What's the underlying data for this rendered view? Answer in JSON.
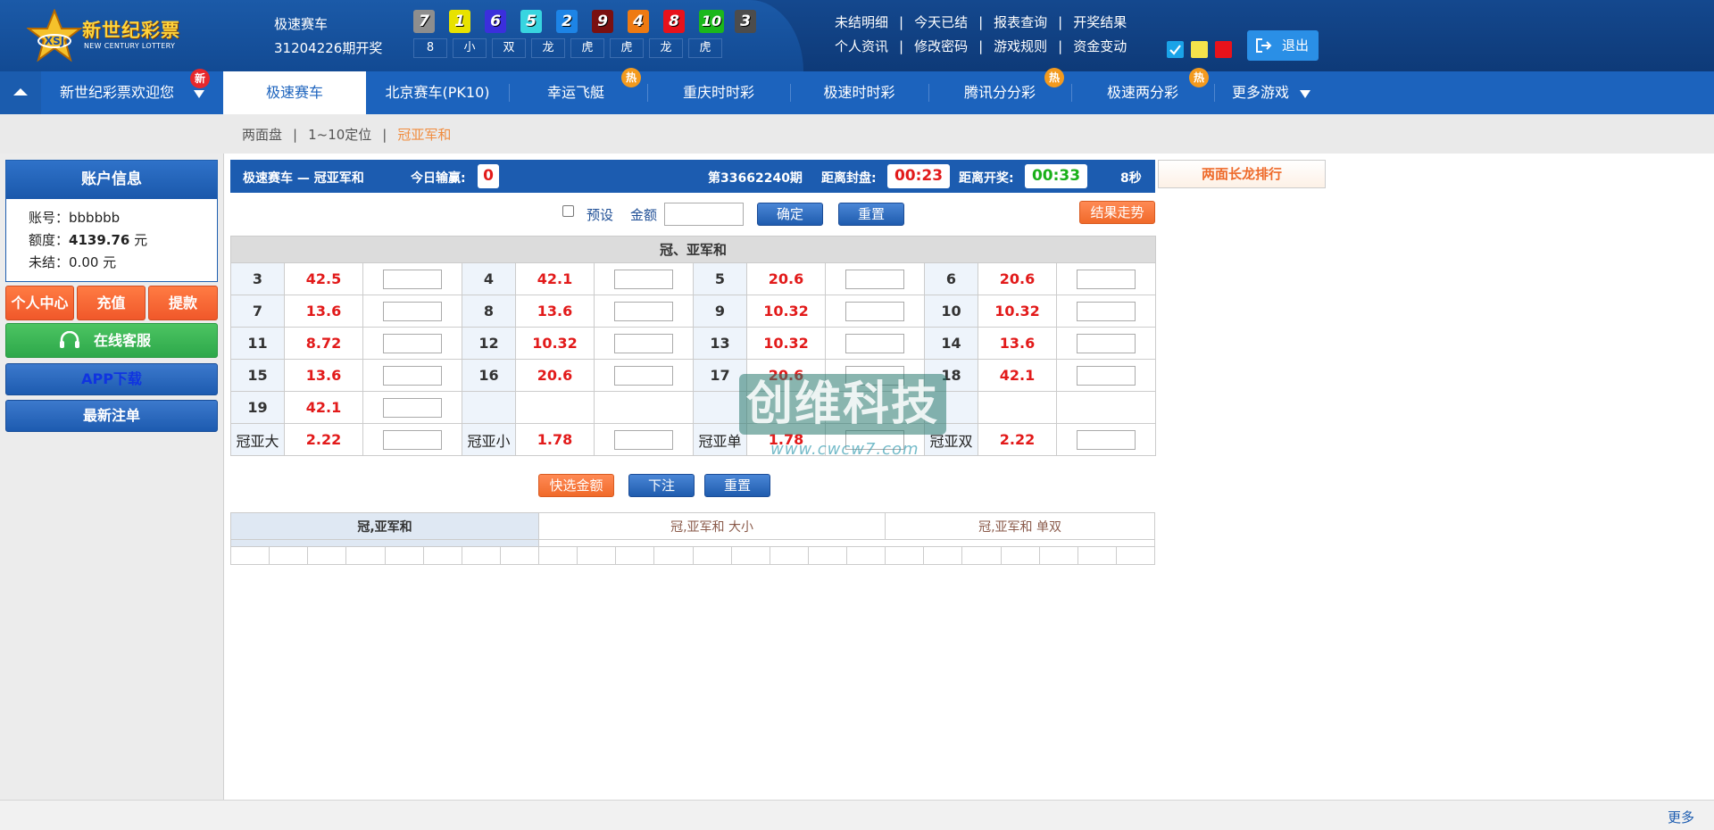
{
  "brand": {
    "logo_cn": "新世纪彩票",
    "logo_en": "NEW CENTURY LOTTERY",
    "logo_badge": "XSJ"
  },
  "header": {
    "game_name": "极速赛车",
    "issue_open": "31204226期开奖",
    "balls": [
      {
        "n": "7",
        "color": "#8e8e8e"
      },
      {
        "n": "1",
        "color": "#e8e200"
      },
      {
        "n": "6",
        "color": "#3b2fdc"
      },
      {
        "n": "5",
        "color": "#38d5e0"
      },
      {
        "n": "2",
        "color": "#1d84e6"
      },
      {
        "n": "9",
        "color": "#7a1010"
      },
      {
        "n": "4",
        "color": "#ee7a12"
      },
      {
        "n": "8",
        "color": "#e8121b"
      },
      {
        "n": "10",
        "color": "#1bb71b"
      },
      {
        "n": "3",
        "color": "#4c4c4c"
      }
    ],
    "results": [
      "8",
      "小",
      "双",
      "龙",
      "虎",
      "虎",
      "龙",
      "虎"
    ],
    "links_row1": [
      "未结明细",
      "今天已结",
      "报表查询",
      "开奖结果"
    ],
    "links_row2": [
      "个人资讯",
      "修改密码",
      "游戏规则",
      "资金变动"
    ],
    "theme_colors": [
      "#1aa3e8",
      "#f4e34b",
      "#e8121b"
    ],
    "logout": "退出"
  },
  "nav": {
    "welcome": "新世纪彩票欢迎您",
    "new_badge": "新",
    "hot_badge": "热",
    "items": [
      "极速赛车",
      "北京赛车(PK10)",
      "幸运飞艇",
      "重庆时时彩",
      "极速时时彩",
      "腾讯分分彩",
      "极速两分彩",
      "更多游戏"
    ]
  },
  "subtabs": [
    "两面盘",
    "1~10定位",
    "冠亚军和"
  ],
  "sidebar": {
    "title": "账户信息",
    "account_label": "账号：",
    "account": "bbbbbb",
    "quota_label": "额度：",
    "quota": "4139.76",
    "quota_unit": "元",
    "unsettled_label": "未结：",
    "unsettled": "0.00 元",
    "btn_center": "个人中心",
    "btn_recharge": "充值",
    "btn_withdraw": "提款",
    "btn_service": "在线客服",
    "btn_app": "APP下载",
    "btn_latest": "最新注单"
  },
  "infobar": {
    "title": "极速赛车 — 冠亚军和",
    "today_label": "今日输赢:",
    "today_value": "0",
    "period": "第33662240期",
    "close_label": "距离封盘:",
    "close_time": "00:23",
    "draw_label": "距离开奖:",
    "draw_time": "00:33",
    "refresh": "8秒"
  },
  "ranking": "两面长龙排行",
  "quick": {
    "preset": "预设",
    "amount": "金额",
    "confirm": "确定",
    "reset": "重置",
    "trend": "结果走势"
  },
  "table": {
    "header": "冠、亚军和",
    "rows": [
      [
        [
          "3",
          "42.5"
        ],
        [
          "4",
          "42.1"
        ],
        [
          "5",
          "20.6"
        ],
        [
          "6",
          "20.6"
        ]
      ],
      [
        [
          "7",
          "13.6"
        ],
        [
          "8",
          "13.6"
        ],
        [
          "9",
          "10.32"
        ],
        [
          "10",
          "10.32"
        ]
      ],
      [
        [
          "11",
          "8.72"
        ],
        [
          "12",
          "10.32"
        ],
        [
          "13",
          "10.32"
        ],
        [
          "14",
          "13.6"
        ]
      ],
      [
        [
          "15",
          "13.6"
        ],
        [
          "16",
          "20.6"
        ],
        [
          "17",
          "20.6"
        ],
        [
          "18",
          "42.1"
        ]
      ],
      [
        [
          "19",
          "42.1"
        ]
      ],
      [
        [
          "冠亚大",
          "2.22"
        ],
        [
          "冠亚小",
          "1.78"
        ],
        [
          "冠亚单",
          "1.78"
        ],
        [
          "冠亚双",
          "2.22"
        ]
      ]
    ]
  },
  "actions": {
    "quick_amount": "快选金额",
    "bet": "下注",
    "reset": "重置"
  },
  "stats": {
    "tab1": "冠,亚军和",
    "tab2": "冠,亚军和 大小",
    "tab3": "冠,亚军和 单双"
  },
  "watermark": {
    "text": "创维科技",
    "url": "www.cwcw7.com"
  },
  "footer": {
    "more": "更多"
  }
}
